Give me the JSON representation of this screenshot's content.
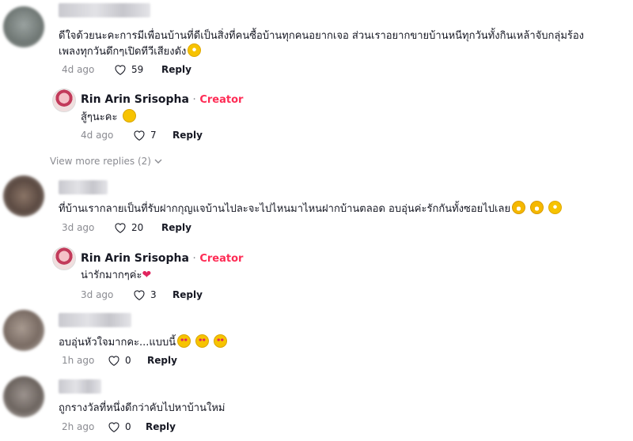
{
  "comments": [
    {
      "text_line1": "ดีใจด้วยนะคะการมีเพื่อนบ้านที่ดีเป็นสิ่งที่คนซื้อบ้านทุกคนอยากเจอ ส่วนเราอยากขายบ้านหนีทุกวันทั้งกินเหล้าจับกลุ่มร้อง",
      "text_line2": "เพลงทุกวันดึกๆเปิดทีวีเสียงดัง",
      "time": "4d ago",
      "likes": "59",
      "reply": "Reply",
      "reply_item": {
        "author": "Rin Arin Srisopha",
        "sep": " · ",
        "tag": "Creator",
        "text": "สู้ๆนะคะ",
        "time": "4d ago",
        "likes": "7",
        "reply": "Reply"
      }
    },
    {
      "text": "ที่บ้านเรากลายเป็นที่รับฝากกุญแจบ้านไปละจะไปไหนมาไหนฝากบ้านตลอด อบอุ่นค่ะรักกันทั้งซอยไปเลย",
      "time": "3d ago",
      "likes": "20",
      "reply": "Reply",
      "reply_item": {
        "author": "Rin Arin Srisopha",
        "sep": " · ",
        "tag": "Creator",
        "text": "น่ารักมากๆค่ะ",
        "time": "3d ago",
        "likes": "3",
        "reply": "Reply"
      }
    },
    {
      "text": "อบอุ่นหัวใจมากคะ...แบบนี้",
      "time": "1h ago",
      "likes": "0",
      "reply": "Reply"
    },
    {
      "text": "ถูกรางวัลที่หนึ่งดีกว่าคับไปหาบ้านใหม่",
      "time": "2h ago",
      "likes": "0",
      "reply": "Reply"
    }
  ],
  "view_more": "View more replies (2)",
  "colors": {
    "creator_tag": "#fe2c55",
    "meta_gray": "#8a8b91",
    "text": "#161823"
  },
  "icons": {
    "like": "heart-outline-icon",
    "expand": "chevron-down-icon"
  }
}
